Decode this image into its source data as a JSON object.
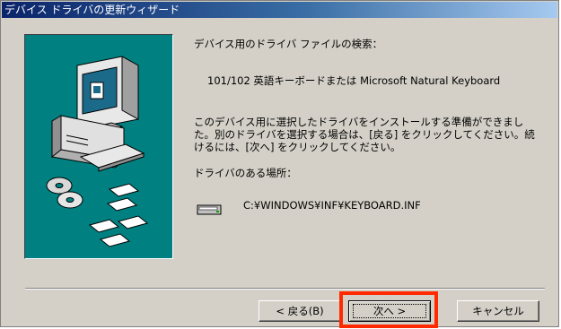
{
  "window": {
    "title": "デバイス ドライバの更新ウィザード"
  },
  "content": {
    "heading": "デバイス用のドライバ ファイルの検索：",
    "device_name": "101/102 英語キーボードまたは Microsoft Natural Keyboard",
    "description": "このデバイス用に選択したドライバをインストールする準備ができました。別のドライバを選択する場合は、[戻る] をクリックしてください。続けるには、[次へ] をクリックしてください。",
    "location_label": "ドライバのある場所：",
    "driver_path": "C:¥WINDOWS¥INF¥KEYBOARD.INF"
  },
  "buttons": {
    "back": "< 戻る(B)",
    "next": "次へ >",
    "cancel": "キャンセル"
  },
  "icons": {
    "wizard_graphic": "computer-with-disks-icon",
    "drive": "drive-icon"
  },
  "colors": {
    "title_start": "#0a246a",
    "title_end": "#a6caf0",
    "dialog": "#d4d0c8",
    "graphic_bg": "#008080",
    "highlight": "#ff2a00"
  }
}
